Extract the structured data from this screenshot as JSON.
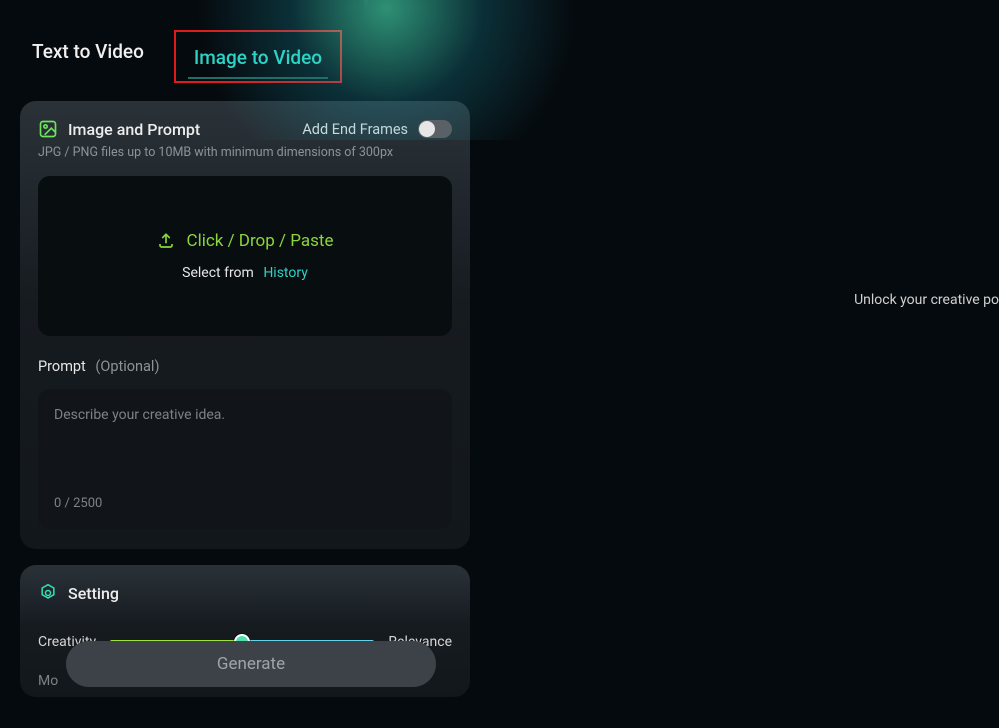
{
  "tabs": {
    "text_to_video": "Text to Video",
    "image_to_video": "Image to Video"
  },
  "side_text": "Unlock your creative po",
  "image_prompt": {
    "title": "Image and Prompt",
    "end_frames_label": "Add End Frames",
    "hint": "JPG / PNG files up to 10MB with minimum dimensions of 300px",
    "drop_main": "Click / Drop / Paste",
    "drop_sub_prefix": "Select from",
    "drop_sub_link": "History"
  },
  "prompt": {
    "label": "Prompt",
    "optional": "(Optional)",
    "placeholder": "Describe your creative idea.",
    "counter": "0 / 2500"
  },
  "setting": {
    "title": "Setting",
    "left_label": "Creativity",
    "right_label": "Relevance",
    "mo": "Mo",
    "generate": "Generate"
  }
}
